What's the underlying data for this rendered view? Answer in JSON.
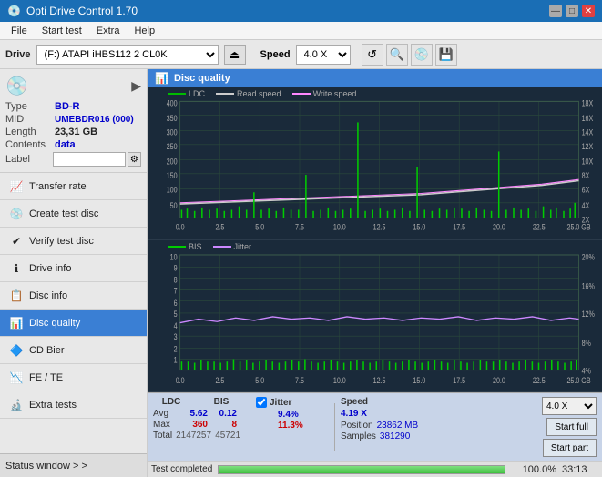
{
  "titlebar": {
    "title": "Opti Drive Control 1.70",
    "icon": "💿",
    "minimize": "—",
    "maximize": "□",
    "close": "✕"
  },
  "menubar": {
    "items": [
      "File",
      "Start test",
      "Extra",
      "Help"
    ]
  },
  "drivebar": {
    "label": "Drive",
    "drive_value": "(F:)  ATAPI iHBS112  2 CL0K",
    "speed_label": "Speed",
    "speed_value": "4.0 X"
  },
  "disc": {
    "type_label": "Type",
    "type_value": "BD-R",
    "mid_label": "MID",
    "mid_value": "UMEBDR016 (000)",
    "length_label": "Length",
    "length_value": "23,31 GB",
    "contents_label": "Contents",
    "contents_value": "data",
    "label_label": "Label",
    "label_value": ""
  },
  "sidebar": {
    "items": [
      {
        "id": "transfer-rate",
        "label": "Transfer rate",
        "icon": "📈"
      },
      {
        "id": "create-test-disc",
        "label": "Create test disc",
        "icon": "💿"
      },
      {
        "id": "verify-test-disc",
        "label": "Verify test disc",
        "icon": "✔"
      },
      {
        "id": "drive-info",
        "label": "Drive info",
        "icon": "ℹ"
      },
      {
        "id": "disc-info",
        "label": "Disc info",
        "icon": "📋"
      },
      {
        "id": "disc-quality",
        "label": "Disc quality",
        "icon": "📊",
        "active": true
      },
      {
        "id": "cd-bier",
        "label": "CD Bier",
        "icon": "🔷"
      },
      {
        "id": "fe-te",
        "label": "FE / TE",
        "icon": "📉"
      },
      {
        "id": "extra-tests",
        "label": "Extra tests",
        "icon": "🔬"
      }
    ],
    "status_window": "Status window > >"
  },
  "disc_quality": {
    "title": "Disc quality",
    "legend": {
      "ldc": "LDC",
      "read_speed": "Read speed",
      "write_speed": "Write speed",
      "bis": "BIS",
      "jitter": "Jitter"
    },
    "chart1": {
      "y_max": 400,
      "y_labels_left": [
        "400",
        "350",
        "300",
        "250",
        "200",
        "150",
        "100",
        "50"
      ],
      "y_labels_right": [
        "18X",
        "16X",
        "14X",
        "12X",
        "10X",
        "8X",
        "6X",
        "4X",
        "2X"
      ],
      "x_labels": [
        "0.0",
        "2.5",
        "5.0",
        "7.5",
        "10.0",
        "12.5",
        "15.0",
        "17.5",
        "20.0",
        "22.5",
        "25.0 GB"
      ]
    },
    "chart2": {
      "y_labels_left": [
        "10",
        "9",
        "8",
        "7",
        "6",
        "5",
        "4",
        "3",
        "2",
        "1"
      ],
      "y_labels_right": [
        "20%",
        "16%",
        "12%",
        "8%",
        "4%"
      ],
      "x_labels": [
        "0.0",
        "2.5",
        "5.0",
        "7.5",
        "10.0",
        "12.5",
        "15.0",
        "17.5",
        "20.0",
        "22.5",
        "25.0 GB"
      ]
    }
  },
  "stats": {
    "headers": [
      "LDC",
      "BIS",
      "",
      "Jitter",
      "Speed",
      "",
      ""
    ],
    "avg_label": "Avg",
    "avg_ldc": "5.62",
    "avg_bis": "0.12",
    "avg_jitter": "9.4%",
    "avg_speed": "4.19 X",
    "max_label": "Max",
    "max_ldc": "360",
    "max_bis": "8",
    "max_jitter": "11.3%",
    "total_label": "Total",
    "total_ldc": "2147257",
    "total_bis": "45721",
    "position_label": "Position",
    "position_value": "23862 MB",
    "samples_label": "Samples",
    "samples_value": "381290",
    "speed_select": "4.0 X",
    "jitter_checked": true,
    "btn_start_full": "Start full",
    "btn_start_part": "Start part"
  },
  "progress": {
    "percent": 100,
    "percent_text": "100.0%",
    "time": "33:13",
    "status": "Test completed"
  },
  "colors": {
    "accent_blue": "#3a7fd4",
    "chart_bg": "#1a2a3a",
    "grid_color": "#2a5a3a",
    "ldc_color": "#00aa00",
    "read_speed_color": "#cccccc",
    "write_speed_color": "#ff88ff",
    "bis_color": "#00cc00",
    "jitter_color": "#cc88ff"
  }
}
